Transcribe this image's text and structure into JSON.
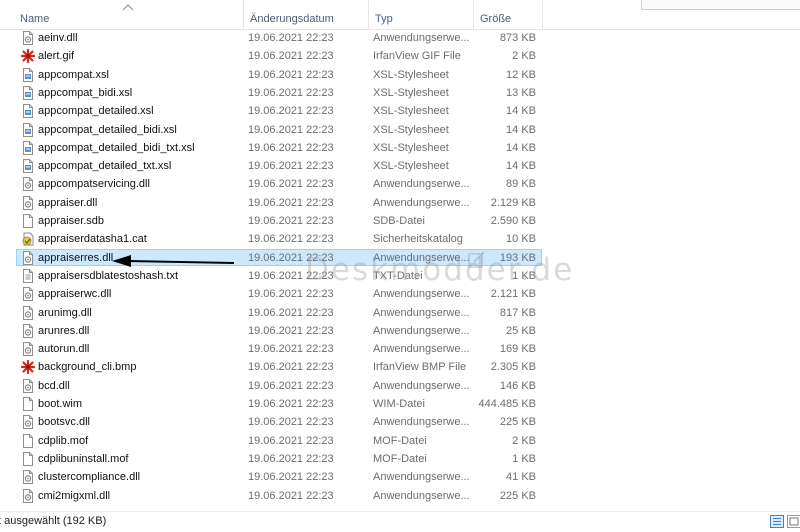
{
  "columns": {
    "name": "Name",
    "date": "Änderungsdatum",
    "type": "Typ",
    "size": "Größe"
  },
  "files": [
    {
      "name": "aeinv.dll",
      "date": "19.06.2021 22:23",
      "type": "Anwendungserwe...",
      "size": "873 KB",
      "icon": "dll-file-icon"
    },
    {
      "name": "alert.gif",
      "date": "19.06.2021 22:23",
      "type": "IrfanView GIF File",
      "size": "2 KB",
      "icon": "irfanview-image-icon"
    },
    {
      "name": "appcompat.xsl",
      "date": "19.06.2021 22:23",
      "type": "XSL-Stylesheet",
      "size": "12 KB",
      "icon": "xsl-file-icon"
    },
    {
      "name": "appcompat_bidi.xsl",
      "date": "19.06.2021 22:23",
      "type": "XSL-Stylesheet",
      "size": "13 KB",
      "icon": "xsl-file-icon"
    },
    {
      "name": "appcompat_detailed.xsl",
      "date": "19.06.2021 22:23",
      "type": "XSL-Stylesheet",
      "size": "14 KB",
      "icon": "xsl-file-icon"
    },
    {
      "name": "appcompat_detailed_bidi.xsl",
      "date": "19.06.2021 22:23",
      "type": "XSL-Stylesheet",
      "size": "14 KB",
      "icon": "xsl-file-icon"
    },
    {
      "name": "appcompat_detailed_bidi_txt.xsl",
      "date": "19.06.2021 22:23",
      "type": "XSL-Stylesheet",
      "size": "14 KB",
      "icon": "xsl-file-icon"
    },
    {
      "name": "appcompat_detailed_txt.xsl",
      "date": "19.06.2021 22:23",
      "type": "XSL-Stylesheet",
      "size": "14 KB",
      "icon": "xsl-file-icon"
    },
    {
      "name": "appcompatservicing.dll",
      "date": "19.06.2021 22:23",
      "type": "Anwendungserwe...",
      "size": "89 KB",
      "icon": "dll-file-icon"
    },
    {
      "name": "appraiser.dll",
      "date": "19.06.2021 22:23",
      "type": "Anwendungserwe...",
      "size": "2.129 KB",
      "icon": "dll-file-icon"
    },
    {
      "name": "appraiser.sdb",
      "date": "19.06.2021 22:23",
      "type": "SDB-Datei",
      "size": "2.590 KB",
      "icon": "blank-file-icon"
    },
    {
      "name": "appraiserdatasha1.cat",
      "date": "19.06.2021 22:23",
      "type": "Sicherheitskatalog",
      "size": "10 KB",
      "icon": "catalog-file-icon"
    },
    {
      "name": "appraiserres.dll",
      "date": "19.06.2021 22:23",
      "type": "Anwendungserwe...",
      "size": "193 KB",
      "icon": "dll-file-icon",
      "selected": true
    },
    {
      "name": "appraisersdblatestoshash.txt",
      "date": "19.06.2021 22:23",
      "type": "TXT-Datei",
      "size": "1 KB",
      "icon": "text-file-icon"
    },
    {
      "name": "appraiserwc.dll",
      "date": "19.06.2021 22:23",
      "type": "Anwendungserwe...",
      "size": "2.121 KB",
      "icon": "dll-file-icon"
    },
    {
      "name": "arunimg.dll",
      "date": "19.06.2021 22:23",
      "type": "Anwendungserwe...",
      "size": "817 KB",
      "icon": "dll-file-icon"
    },
    {
      "name": "arunres.dll",
      "date": "19.06.2021 22:23",
      "type": "Anwendungserwe...",
      "size": "25 KB",
      "icon": "dll-file-icon"
    },
    {
      "name": "autorun.dll",
      "date": "19.06.2021 22:23",
      "type": "Anwendungserwe...",
      "size": "169 KB",
      "icon": "dll-file-icon"
    },
    {
      "name": "background_cli.bmp",
      "date": "19.06.2021 22:23",
      "type": "IrfanView BMP File",
      "size": "2.305 KB",
      "icon": "irfanview-image-icon"
    },
    {
      "name": "bcd.dll",
      "date": "19.06.2021 22:23",
      "type": "Anwendungserwe...",
      "size": "146 KB",
      "icon": "dll-file-icon"
    },
    {
      "name": "boot.wim",
      "date": "19.06.2021 22:23",
      "type": "WIM-Datei",
      "size": "444.485 KB",
      "icon": "blank-file-icon"
    },
    {
      "name": "bootsvc.dll",
      "date": "19.06.2021 22:23",
      "type": "Anwendungserwe...",
      "size": "225 KB",
      "icon": "dll-file-icon"
    },
    {
      "name": "cdplib.mof",
      "date": "19.06.2021 22:23",
      "type": "MOF-Datei",
      "size": "2 KB",
      "icon": "blank-file-icon"
    },
    {
      "name": "cdplibuninstall.mof",
      "date": "19.06.2021 22:23",
      "type": "MOF-Datei",
      "size": "1 KB",
      "icon": "blank-file-icon"
    },
    {
      "name": "clustercompliance.dll",
      "date": "19.06.2021 22:23",
      "type": "Anwendungserwe...",
      "size": "41 KB",
      "icon": "dll-file-icon"
    },
    {
      "name": "cmi2migxml.dll",
      "date": "19.06.2021 22:23",
      "type": "Anwendungserwe...",
      "size": "225 KB",
      "icon": "dll-file-icon"
    }
  ],
  "status": {
    "text": "t ausgewählt (192 KB)"
  },
  "watermark": {
    "text": "Deskmodder.de"
  },
  "colors": {
    "selection_fill": "#cce8ff",
    "selection_border": "#99d1ff",
    "header_text": "#4c607a",
    "secondary_text": "#6d6d6d",
    "irfanview_red": "#d42a1e"
  }
}
